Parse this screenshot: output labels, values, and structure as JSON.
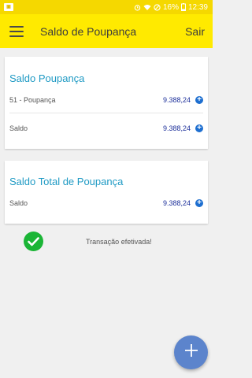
{
  "status_bar": {
    "app_icon": "app-notification-icon",
    "battery": "16%",
    "time": "12:39"
  },
  "app_bar": {
    "title": "Saldo de Poupança",
    "logout_label": "Sair"
  },
  "savings_card": {
    "title": "Saldo Poupança",
    "rows": [
      {
        "label": "51 - Poupança",
        "value": "9.388,24"
      },
      {
        "label": "Saldo",
        "value": "9.388,24"
      }
    ]
  },
  "total_card": {
    "title": "Saldo Total de Poupança",
    "rows": [
      {
        "label": "Saldo",
        "value": "9.388,24"
      }
    ]
  },
  "message": {
    "text": "Transação efetivada!"
  },
  "colors": {
    "status_bar": "#f5d800",
    "app_bar": "#ffea00",
    "title_blue": "#1f9ac4",
    "value_blue": "#1c2f9a",
    "plus_blue": "#1e6fd0",
    "success_green": "#1bb536",
    "fab": "#5c84cc"
  }
}
